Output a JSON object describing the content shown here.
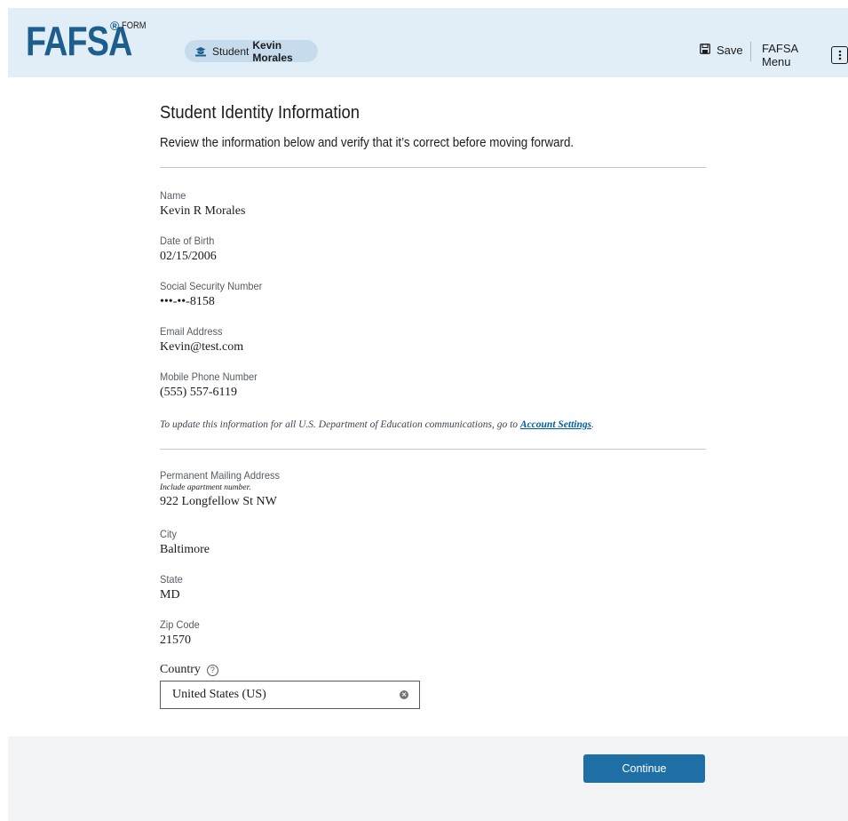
{
  "header": {
    "logo_text": "FAFSA",
    "logo_reg": "®",
    "logo_form": "FORM",
    "student_pill": {
      "label": "Student",
      "name": "Kevin Morales",
      "icon": "student-icon"
    },
    "save_label": "Save",
    "menu_label": "FAFSA Menu"
  },
  "main": {
    "title": "Student Identity Information",
    "subtitle": "Review the information below and verify that it’s correct before moving forward.",
    "fields": [
      {
        "label": "Name",
        "value": "Kevin R Morales"
      },
      {
        "label": "Date of Birth",
        "value": "02/15/2006"
      },
      {
        "label": "Social Security Number",
        "value": "•••-••-8158"
      },
      {
        "label": "Email Address",
        "value": "Kevin@test.com"
      },
      {
        "label": "Mobile Phone Number",
        "value": "(555) 557-6119"
      }
    ],
    "note_prefix": "To update this information for all U.S. Department of Education communications, go to ",
    "note_link": "Account Settings",
    "note_suffix": ".",
    "address": {
      "label": "Permanent Mailing Address",
      "sublabel": "Include apartment number.",
      "value": "922 Longfellow St NW"
    },
    "city": {
      "label": "City",
      "value": "Baltimore"
    },
    "state": {
      "label": "State",
      "value": "MD"
    },
    "zip": {
      "label": "Zip Code",
      "value": "21570"
    },
    "country": {
      "label": "Country",
      "help": "?",
      "value": "United States (US)"
    }
  },
  "footer": {
    "continue_label": "Continue"
  },
  "colors": {
    "header_bg": "#e1eef7",
    "brand": "#1d5e8c",
    "primary_button": "#1d6fa5",
    "link": "#005ea2"
  }
}
